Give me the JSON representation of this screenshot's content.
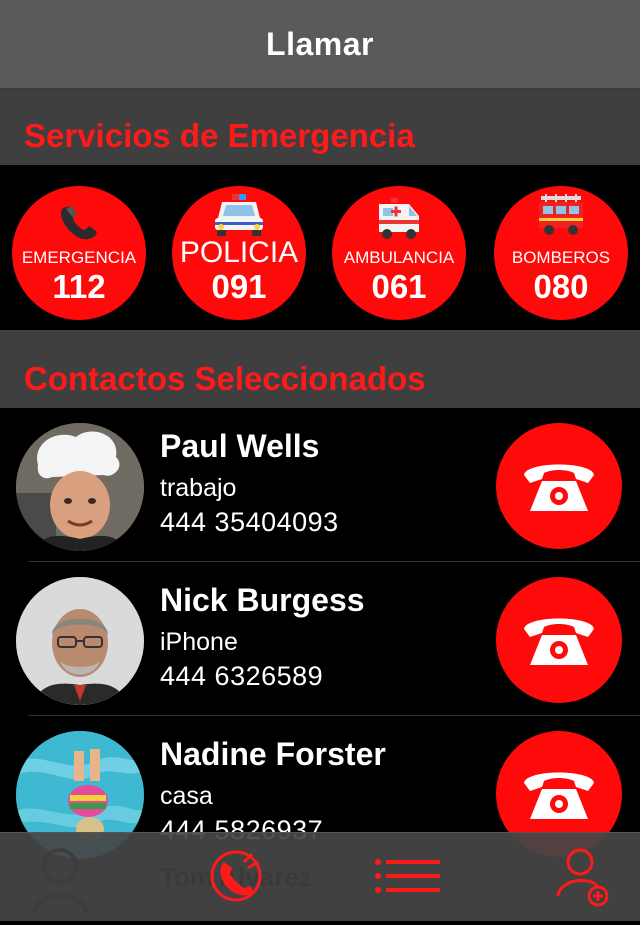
{
  "header": {
    "title": "Llamar"
  },
  "sections": {
    "emergency_title": "Servicios de Emergencia",
    "contacts_title": "Contactos Seleccionados"
  },
  "emergency": [
    {
      "label": "EMERGENCIA",
      "number": "112",
      "icon": "telephone-icon"
    },
    {
      "label": "POLICIA",
      "number": "091",
      "icon": "police-car-icon"
    },
    {
      "label": "AMBULANCIA",
      "number": "061",
      "icon": "ambulance-icon"
    },
    {
      "label": "BOMBEROS",
      "number": "080",
      "icon": "fire-engine-icon"
    }
  ],
  "contacts": [
    {
      "name": "Paul Wells",
      "type": "trabajo",
      "phone": "444 35404093"
    },
    {
      "name": "Nick Burgess",
      "type": "iPhone",
      "phone": "444 6326589"
    },
    {
      "name": "Nadine Forster",
      "type": "casa",
      "phone": "444 5826937"
    }
  ],
  "ghost_contact": {
    "name": "Tom Alvarez"
  },
  "tabs": [
    {
      "id": "tab-contacts",
      "icon": "contacts-icon",
      "active": false
    },
    {
      "id": "tab-call",
      "icon": "phone-call-icon",
      "active": true
    },
    {
      "id": "tab-list",
      "icon": "list-icon",
      "active": false
    },
    {
      "id": "tab-add-contact",
      "icon": "add-contact-icon",
      "active": false
    }
  ],
  "colors": {
    "accent": "#ff0a0a",
    "header_bg": "#5a5a5a",
    "section_bg": "#3f3f3f",
    "background": "#000000"
  }
}
